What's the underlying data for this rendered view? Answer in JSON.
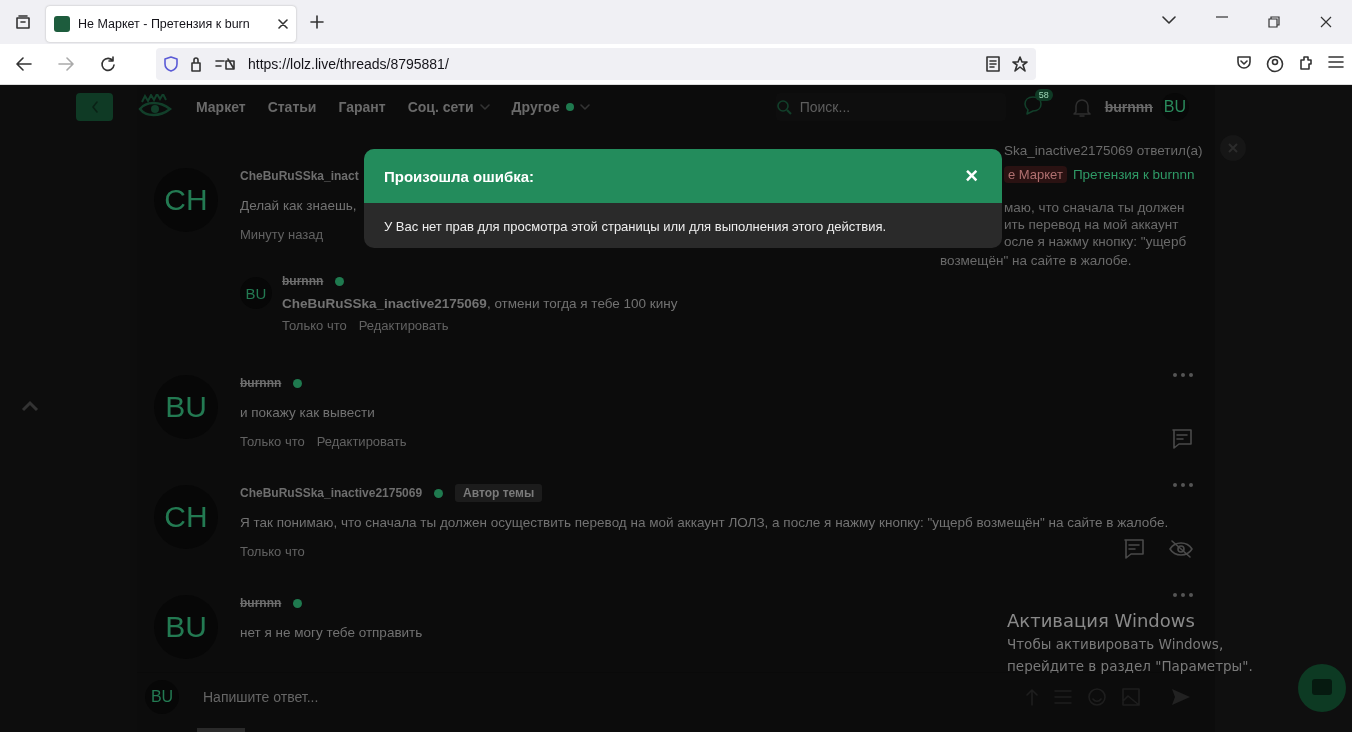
{
  "browser": {
    "tab_title": "Не Маркет - Претензия к burn",
    "url": "https://lolz.live/threads/8795881/"
  },
  "header": {
    "nav": [
      {
        "label": "Маркет",
        "dropdown": false,
        "dot": false
      },
      {
        "label": "Статьи",
        "dropdown": false,
        "dot": false
      },
      {
        "label": "Гарант",
        "dropdown": false,
        "dot": false
      },
      {
        "label": "Соц. сети",
        "dropdown": true,
        "dot": false
      },
      {
        "label": "Другое",
        "dropdown": true,
        "dot": true
      }
    ],
    "search": {
      "placeholder": "Поиск..."
    },
    "messages_badge": "58",
    "username": "burnnn",
    "username_struck": true,
    "avatar": "BU"
  },
  "posts": [
    {
      "avatar": "CH",
      "author": "CheBuRuSSka_inact",
      "struck": false,
      "online": false,
      "text": "Делай как знаешь,",
      "time": "Минуту назад",
      "menu": false,
      "reply_button": false,
      "hide_button": false,
      "comments": [
        {
          "avatar": "BU",
          "author": "burnnn",
          "struck": true,
          "online": true,
          "text": "**CheBuRuSSka_inactive2175069**, отмени тогда я тебе 100 кину",
          "time": "Только что",
          "edit": "Редактировать"
        }
      ]
    },
    {
      "avatar": "BU",
      "author": "burnnn",
      "struck": true,
      "online": true,
      "text": "и покажу как вывести",
      "time": "Только что",
      "edit": "Редактировать",
      "menu": true,
      "reply_button": true,
      "hide_button": false
    },
    {
      "avatar": "CH",
      "author": "CheBuRuSSka_inactive2175069",
      "struck": false,
      "online": true,
      "badge": "Автор темы",
      "text": "Я так понимаю, что сначала ты должен осуществить перевод на мой аккаунт ЛОЛЗ, а после я нажму кнопку: \"ущерб возмещён\" на сайте в жалобе.",
      "time": "Только что",
      "menu": true,
      "reply_button": true,
      "hide_button": true
    },
    {
      "avatar": "BU",
      "author": "burnnn",
      "struck": true,
      "online": true,
      "text": "нет я не могу тебе отправить",
      "menu": true,
      "reply_button": false,
      "hide_button": false
    }
  ],
  "reply_box": {
    "avatar": "BU",
    "placeholder": "Напишите ответ..."
  },
  "notification": {
    "author": "Ska_inactive2175069 ответил(а)",
    "tag": "е Маркет",
    "thread": "Претензия к burnnn",
    "lines": [
      "маю, что сначала ты должен",
      "ить перевод на мой аккаунт",
      "осле я нажму кнопку: \"ущерб"
    ],
    "last_line": "возмещён\" на сайте в жалобе."
  },
  "modal": {
    "title": "Произошла ошибка:",
    "message": "У Вас нет прав для просмотра этой страницы или для выполнения этого действия.",
    "close": "×"
  },
  "os_notice": {
    "title": "Активация Windows",
    "text": "Чтобы активировать Windows, перейдите в раздел \"Параметры\"."
  }
}
